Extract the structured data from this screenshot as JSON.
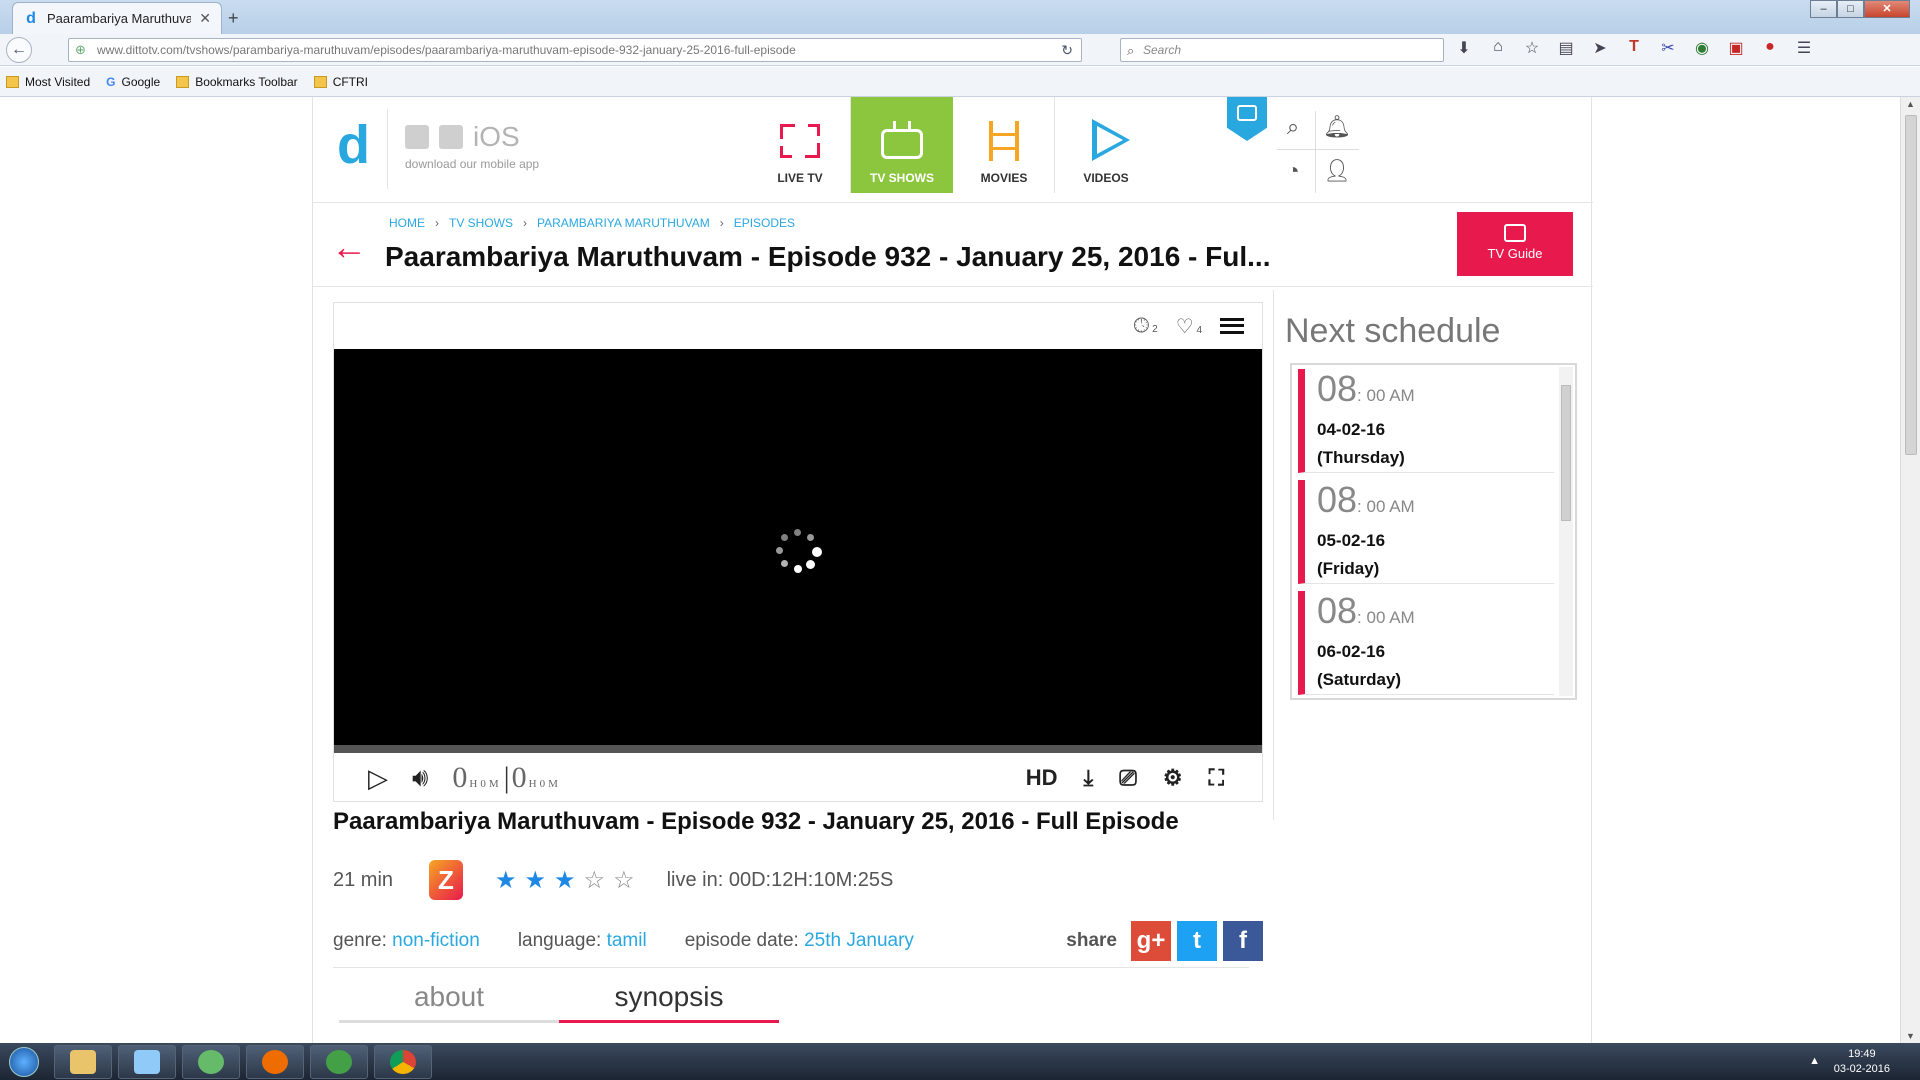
{
  "browser": {
    "tab_title": "Paarambariya Maruthuva...",
    "url": "www.dittotv.com/tvshows/parambariya-maruthuvam/episodes/paarambariya-maruthuvam-episode-932-january-25-2016-full-episode",
    "search_placeholder": "Search",
    "bookmarks": [
      "Most Visited",
      "Google",
      "Bookmarks Toolbar",
      "CFTRI"
    ]
  },
  "site": {
    "logo": "d",
    "apps_os": "iOS",
    "apps_caption": "download our mobile app",
    "nav": [
      {
        "label": "LIVE TV"
      },
      {
        "label": "TV SHOWS"
      },
      {
        "label": "MOVIES"
      },
      {
        "label": "VIDEOS"
      }
    ],
    "active_nav": "TV SHOWS"
  },
  "breadcrumb": [
    "HOME",
    "TV SHOWS",
    "PARAMBARIYA MARUTHUVAM",
    "EPISODES"
  ],
  "page_title": "Paarambariya Maruthuvam - Episode 932 - January 25, 2016 - Ful...",
  "tv_guide_label": "TV Guide",
  "player": {
    "watch_later_count": "2",
    "likes_count": "4",
    "time_current": "0",
    "time_current_unit": "H0M",
    "time_total": "0",
    "time_total_unit": "H0M",
    "hd_label": "HD"
  },
  "episode": {
    "title": "Paarambariya Maruthuvam - Episode 932 - January 25, 2016 - Full Episode",
    "duration": "21 min",
    "rating": 3,
    "rating_max": 5,
    "live_in_label": "live in:",
    "live_in_value": "00D:12H:10M:25S",
    "genre_label": "genre:",
    "genre": "non-fiction",
    "language_label": "language:",
    "language": "tamil",
    "episode_date_label": "episode date:",
    "episode_date": "25th January",
    "share_label": "share"
  },
  "tabs": [
    "about",
    "synopsis"
  ],
  "active_tab": "synopsis",
  "schedule": {
    "heading": "Next schedule",
    "items": [
      {
        "hour": "08",
        "rest": ": 00 AM",
        "date": "04-02-16",
        "day": "(Thursday)"
      },
      {
        "hour": "08",
        "rest": ": 00 AM",
        "date": "05-02-16",
        "day": "(Friday)"
      },
      {
        "hour": "08",
        "rest": ": 00 AM",
        "date": "06-02-16",
        "day": "(Saturday)"
      }
    ]
  },
  "taskbar": {
    "time": "19:49",
    "date": "03-02-2016"
  },
  "colors": {
    "accent_pink": "#e8194c",
    "accent_green": "#8cc63e",
    "accent_blue": "#29a8e0",
    "accent_orange": "#f6a623"
  }
}
